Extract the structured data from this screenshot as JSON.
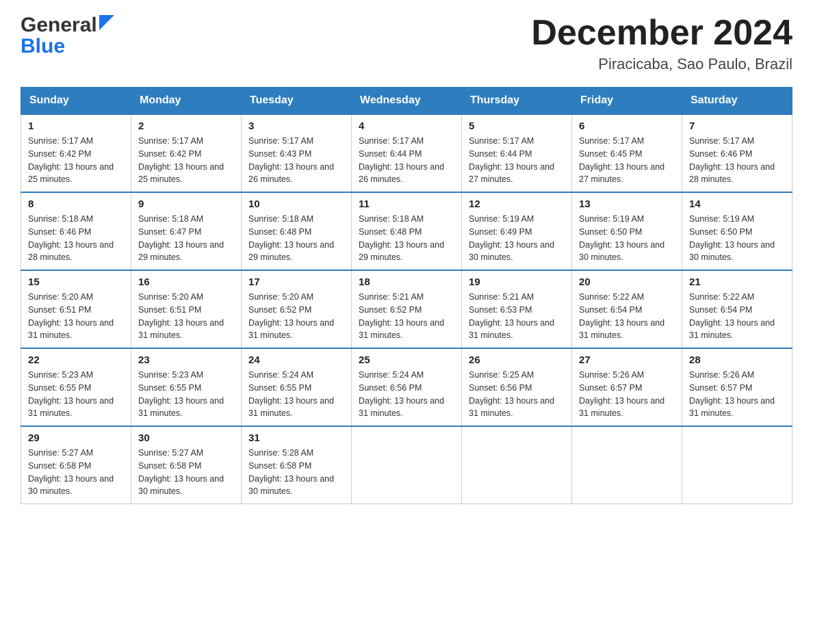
{
  "header": {
    "logo_line1": "General",
    "logo_line2": "Blue",
    "title": "December 2024",
    "subtitle": "Piracicaba, Sao Paulo, Brazil"
  },
  "days_of_week": [
    "Sunday",
    "Monday",
    "Tuesday",
    "Wednesday",
    "Thursday",
    "Friday",
    "Saturday"
  ],
  "weeks": [
    [
      {
        "day": "1",
        "sunrise": "5:17 AM",
        "sunset": "6:42 PM",
        "daylight": "13 hours and 25 minutes."
      },
      {
        "day": "2",
        "sunrise": "5:17 AM",
        "sunset": "6:42 PM",
        "daylight": "13 hours and 25 minutes."
      },
      {
        "day": "3",
        "sunrise": "5:17 AM",
        "sunset": "6:43 PM",
        "daylight": "13 hours and 26 minutes."
      },
      {
        "day": "4",
        "sunrise": "5:17 AM",
        "sunset": "6:44 PM",
        "daylight": "13 hours and 26 minutes."
      },
      {
        "day": "5",
        "sunrise": "5:17 AM",
        "sunset": "6:44 PM",
        "daylight": "13 hours and 27 minutes."
      },
      {
        "day": "6",
        "sunrise": "5:17 AM",
        "sunset": "6:45 PM",
        "daylight": "13 hours and 27 minutes."
      },
      {
        "day": "7",
        "sunrise": "5:17 AM",
        "sunset": "6:46 PM",
        "daylight": "13 hours and 28 minutes."
      }
    ],
    [
      {
        "day": "8",
        "sunrise": "5:18 AM",
        "sunset": "6:46 PM",
        "daylight": "13 hours and 28 minutes."
      },
      {
        "day": "9",
        "sunrise": "5:18 AM",
        "sunset": "6:47 PM",
        "daylight": "13 hours and 29 minutes."
      },
      {
        "day": "10",
        "sunrise": "5:18 AM",
        "sunset": "6:48 PM",
        "daylight": "13 hours and 29 minutes."
      },
      {
        "day": "11",
        "sunrise": "5:18 AM",
        "sunset": "6:48 PM",
        "daylight": "13 hours and 29 minutes."
      },
      {
        "day": "12",
        "sunrise": "5:19 AM",
        "sunset": "6:49 PM",
        "daylight": "13 hours and 30 minutes."
      },
      {
        "day": "13",
        "sunrise": "5:19 AM",
        "sunset": "6:50 PM",
        "daylight": "13 hours and 30 minutes."
      },
      {
        "day": "14",
        "sunrise": "5:19 AM",
        "sunset": "6:50 PM",
        "daylight": "13 hours and 30 minutes."
      }
    ],
    [
      {
        "day": "15",
        "sunrise": "5:20 AM",
        "sunset": "6:51 PM",
        "daylight": "13 hours and 31 minutes."
      },
      {
        "day": "16",
        "sunrise": "5:20 AM",
        "sunset": "6:51 PM",
        "daylight": "13 hours and 31 minutes."
      },
      {
        "day": "17",
        "sunrise": "5:20 AM",
        "sunset": "6:52 PM",
        "daylight": "13 hours and 31 minutes."
      },
      {
        "day": "18",
        "sunrise": "5:21 AM",
        "sunset": "6:52 PM",
        "daylight": "13 hours and 31 minutes."
      },
      {
        "day": "19",
        "sunrise": "5:21 AM",
        "sunset": "6:53 PM",
        "daylight": "13 hours and 31 minutes."
      },
      {
        "day": "20",
        "sunrise": "5:22 AM",
        "sunset": "6:54 PM",
        "daylight": "13 hours and 31 minutes."
      },
      {
        "day": "21",
        "sunrise": "5:22 AM",
        "sunset": "6:54 PM",
        "daylight": "13 hours and 31 minutes."
      }
    ],
    [
      {
        "day": "22",
        "sunrise": "5:23 AM",
        "sunset": "6:55 PM",
        "daylight": "13 hours and 31 minutes."
      },
      {
        "day": "23",
        "sunrise": "5:23 AM",
        "sunset": "6:55 PM",
        "daylight": "13 hours and 31 minutes."
      },
      {
        "day": "24",
        "sunrise": "5:24 AM",
        "sunset": "6:55 PM",
        "daylight": "13 hours and 31 minutes."
      },
      {
        "day": "25",
        "sunrise": "5:24 AM",
        "sunset": "6:56 PM",
        "daylight": "13 hours and 31 minutes."
      },
      {
        "day": "26",
        "sunrise": "5:25 AM",
        "sunset": "6:56 PM",
        "daylight": "13 hours and 31 minutes."
      },
      {
        "day": "27",
        "sunrise": "5:26 AM",
        "sunset": "6:57 PM",
        "daylight": "13 hours and 31 minutes."
      },
      {
        "day": "28",
        "sunrise": "5:26 AM",
        "sunset": "6:57 PM",
        "daylight": "13 hours and 31 minutes."
      }
    ],
    [
      {
        "day": "29",
        "sunrise": "5:27 AM",
        "sunset": "6:58 PM",
        "daylight": "13 hours and 30 minutes."
      },
      {
        "day": "30",
        "sunrise": "5:27 AM",
        "sunset": "6:58 PM",
        "daylight": "13 hours and 30 minutes."
      },
      {
        "day": "31",
        "sunrise": "5:28 AM",
        "sunset": "6:58 PM",
        "daylight": "13 hours and 30 minutes."
      },
      null,
      null,
      null,
      null
    ]
  ]
}
